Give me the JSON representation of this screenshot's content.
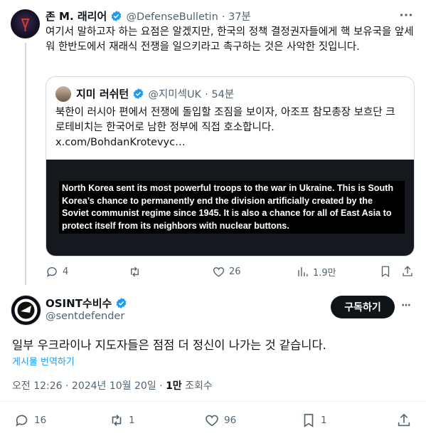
{
  "tweet": {
    "author_name": "존 M. 래리어",
    "author_handle": "@DefenseBulletin",
    "time": "· 37분",
    "text": "여기서 말하고자 하는 요점은 알겠지만, 한국의 정책 결정권자들에게 핵 보유국을 앞세워 한반도에서 재래식 전쟁을 일으키라고 촉구하는 것은 사악한 짓입니다.",
    "quote": {
      "author_name": "지미 러쉬턴",
      "author_handle": "@지미섹UK",
      "time": "· 54분",
      "text": "북한이 러시아 편에서 전쟁에 돌입할 조짐을 보이자, 아조프 참모총장 보흐단 크로테비치는 한국어로 남한 정부에 직접 호소합니다.",
      "link": "x.com/BohdanKrotevyc…",
      "media_text": "North Korea sent its most powerful troops to the war in Ukraine. This is South Korea’s chance to permanently end the division artificially created by the Soviet communist regime since 1945. It is also a chance for all of East Asia to protect itself from its neighbors with nuclear buttons."
    },
    "actions": {
      "replies": "4",
      "retweets": "",
      "likes": "26",
      "views": "1.9만"
    }
  },
  "reply": {
    "author_name": "OSINT수비수",
    "author_handle": "@sentdefender",
    "subscribe_label": "구독하기",
    "more_label": "···",
    "text": "일부 우크라이나 지도자들은 점점 더 정신이 나가는 것 같습니다.",
    "translate_label": "게시물 번역하기",
    "timestamp": "오전 12:26 · 2024년 10월 20일 ·",
    "views_count": "1만",
    "views_label": "조회수",
    "actions": {
      "replies": "16",
      "retweets": "1",
      "likes": "96",
      "bookmarks": "1"
    }
  },
  "colors": {
    "accent": "#1d9bf0",
    "verified": "#1d9bf0",
    "text": "#0f1419",
    "muted": "#536471"
  }
}
